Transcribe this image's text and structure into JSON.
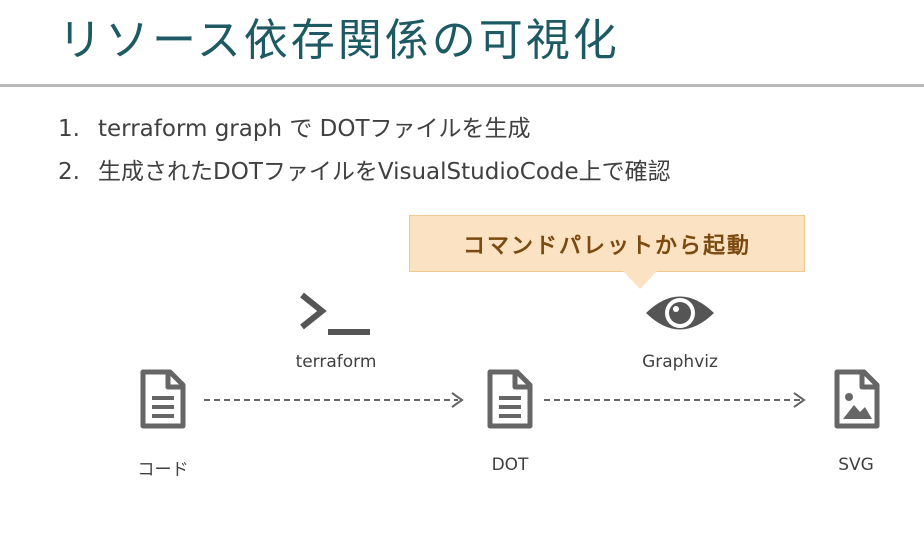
{
  "slide": {
    "title": "リソース依存関係の可視化",
    "steps": [
      {
        "num": "1.",
        "text": "terraform graph で DOTファイルを生成"
      },
      {
        "num": "2.",
        "text": "生成されたDOTファイルをVisualStudioCode上で確認"
      }
    ]
  },
  "callout": {
    "text": "コマンドパレットから起動"
  },
  "diagram": {
    "tools": {
      "terraform": "terraform",
      "graphviz": "Graphviz"
    },
    "nodes": {
      "code": "コード",
      "dot": "DOT",
      "svg": "SVG"
    },
    "icons": [
      "terminal-icon",
      "eye-icon",
      "document-icon",
      "image-file-icon",
      "arrow-right-icon"
    ]
  },
  "colors": {
    "title": "#1e5a63",
    "callout_bg": "#fbe2c3",
    "callout_text": "#7a4a10",
    "icon": "#666666"
  }
}
